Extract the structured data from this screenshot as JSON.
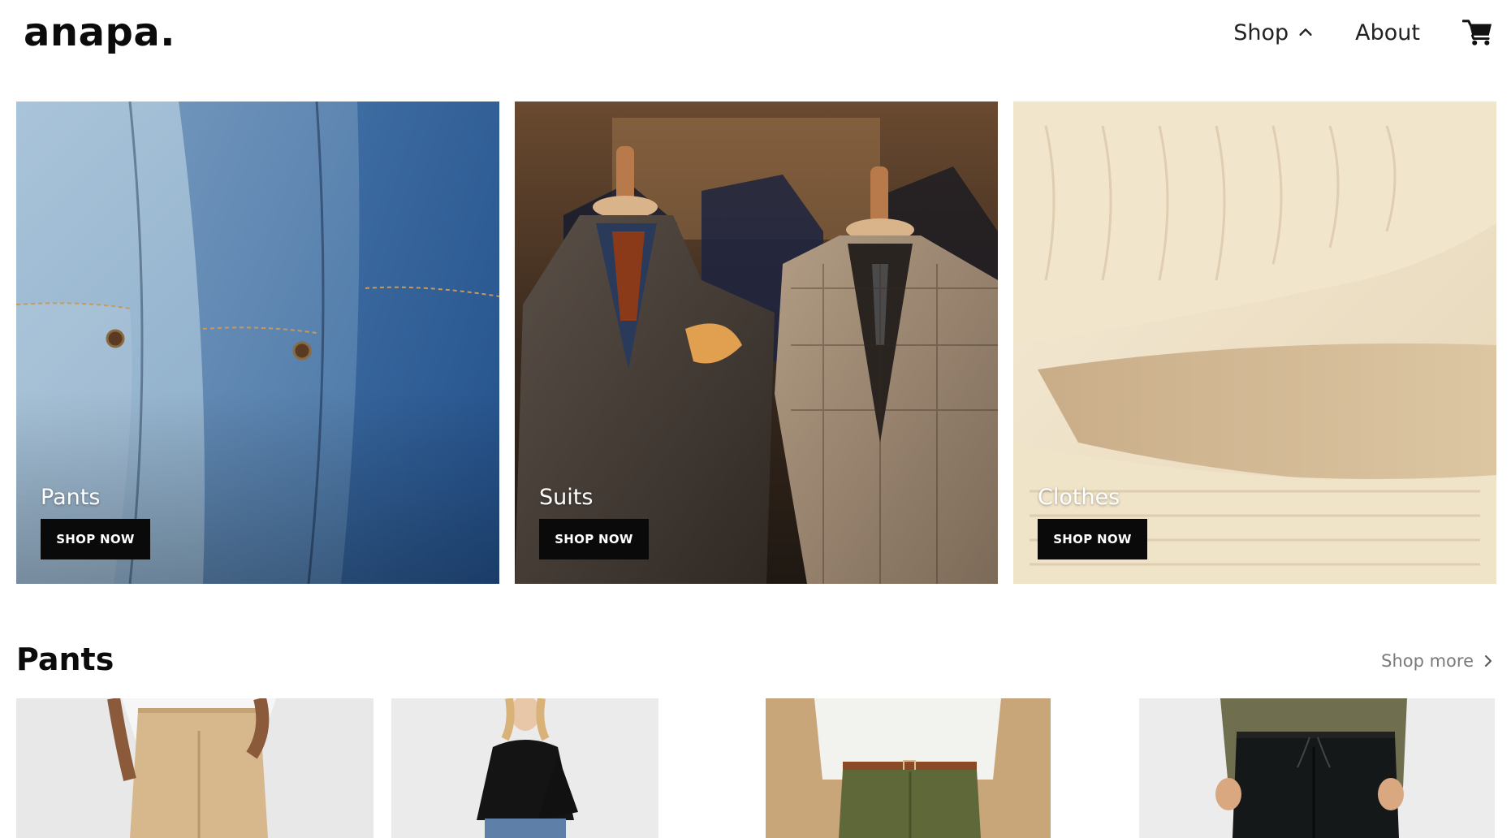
{
  "header": {
    "logo": "anapa.",
    "nav": {
      "shop_label": "Shop",
      "about_label": "About"
    },
    "icons": {
      "shop_chevron": "chevron-up-icon",
      "cart": "cart-icon"
    }
  },
  "categories": [
    {
      "title": "Pants",
      "button": "SHOP NOW",
      "image": "denim jeans pockets"
    },
    {
      "title": "Suits",
      "button": "SHOP NOW",
      "image": "tweed suits on mannequins"
    },
    {
      "title": "Clothes",
      "button": "SHOP NOW",
      "image": "folded knit sweaters"
    }
  ],
  "section": {
    "title": "Pants",
    "shop_more": "Shop more",
    "shop_more_icon": "chevron-right-icon"
  },
  "products": [
    {
      "image": "model in khaki chinos"
    },
    {
      "image": "model in black sweater and jeans"
    },
    {
      "image": "model in olive trousers with belt"
    },
    {
      "image": "model in black joggers"
    }
  ],
  "colors": {
    "button_bg": "#0a0a0a",
    "button_text": "#ffffff",
    "muted_link": "#7a7a7a",
    "text": "#111111"
  }
}
